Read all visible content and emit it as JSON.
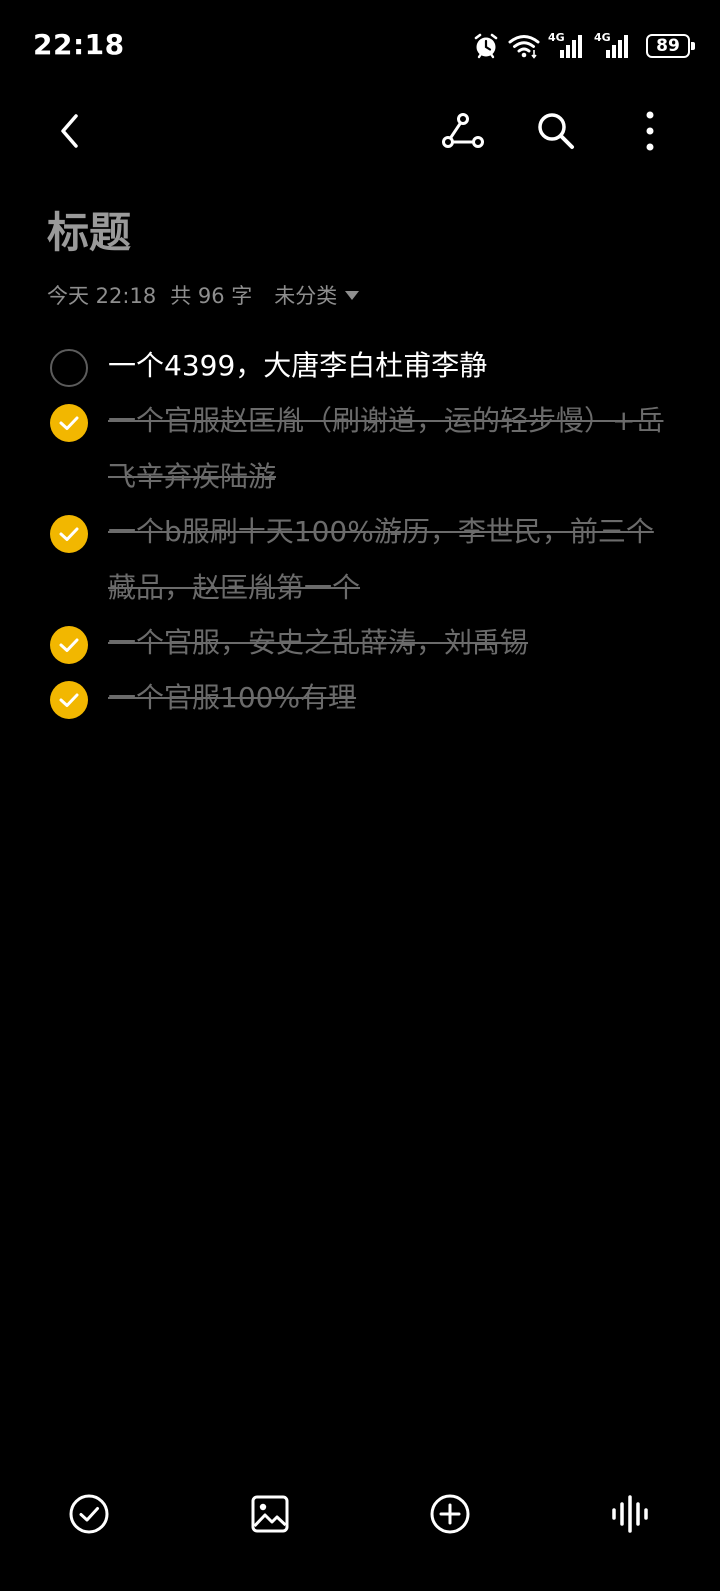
{
  "status_bar": {
    "time": "22:18",
    "battery": "89",
    "network_label_1": "4G",
    "network_label_2": "4G",
    "icons": [
      "alarm-icon",
      "wifi-icon",
      "signal-4g-icon",
      "signal-4g-icon",
      "battery-icon"
    ]
  },
  "toolbar": {
    "icons": [
      "back-icon",
      "share-icon",
      "search-icon",
      "more-icon"
    ]
  },
  "note": {
    "title": "标题",
    "date": "今天 22:18",
    "count_label": "共 96 字",
    "category": "未分类",
    "items": [
      {
        "text": "一个4399，大唐李白杜甫李静",
        "checked": false
      },
      {
        "text": "一个官服赵匡胤（刷谢道，运的轻步慢）+岳飞辛弃疾陆游",
        "checked": true
      },
      {
        "text": "一个b服刷十天100%游历，李世民，前三个藏品，赵匡胤第一个",
        "checked": true
      },
      {
        "text": "一个官服，安史之乱薛涛，刘禹锡",
        "checked": true
      },
      {
        "text": "一个官服100%有理",
        "checked": true
      }
    ]
  },
  "bottom_bar": {
    "icons": [
      "checklist-icon",
      "image-icon",
      "add-icon",
      "voice-icon"
    ]
  },
  "colors": {
    "background": "#000000",
    "accent": "#f2b700",
    "done_text": "#6b6b6b",
    "title_text": "#9a9a9a"
  }
}
